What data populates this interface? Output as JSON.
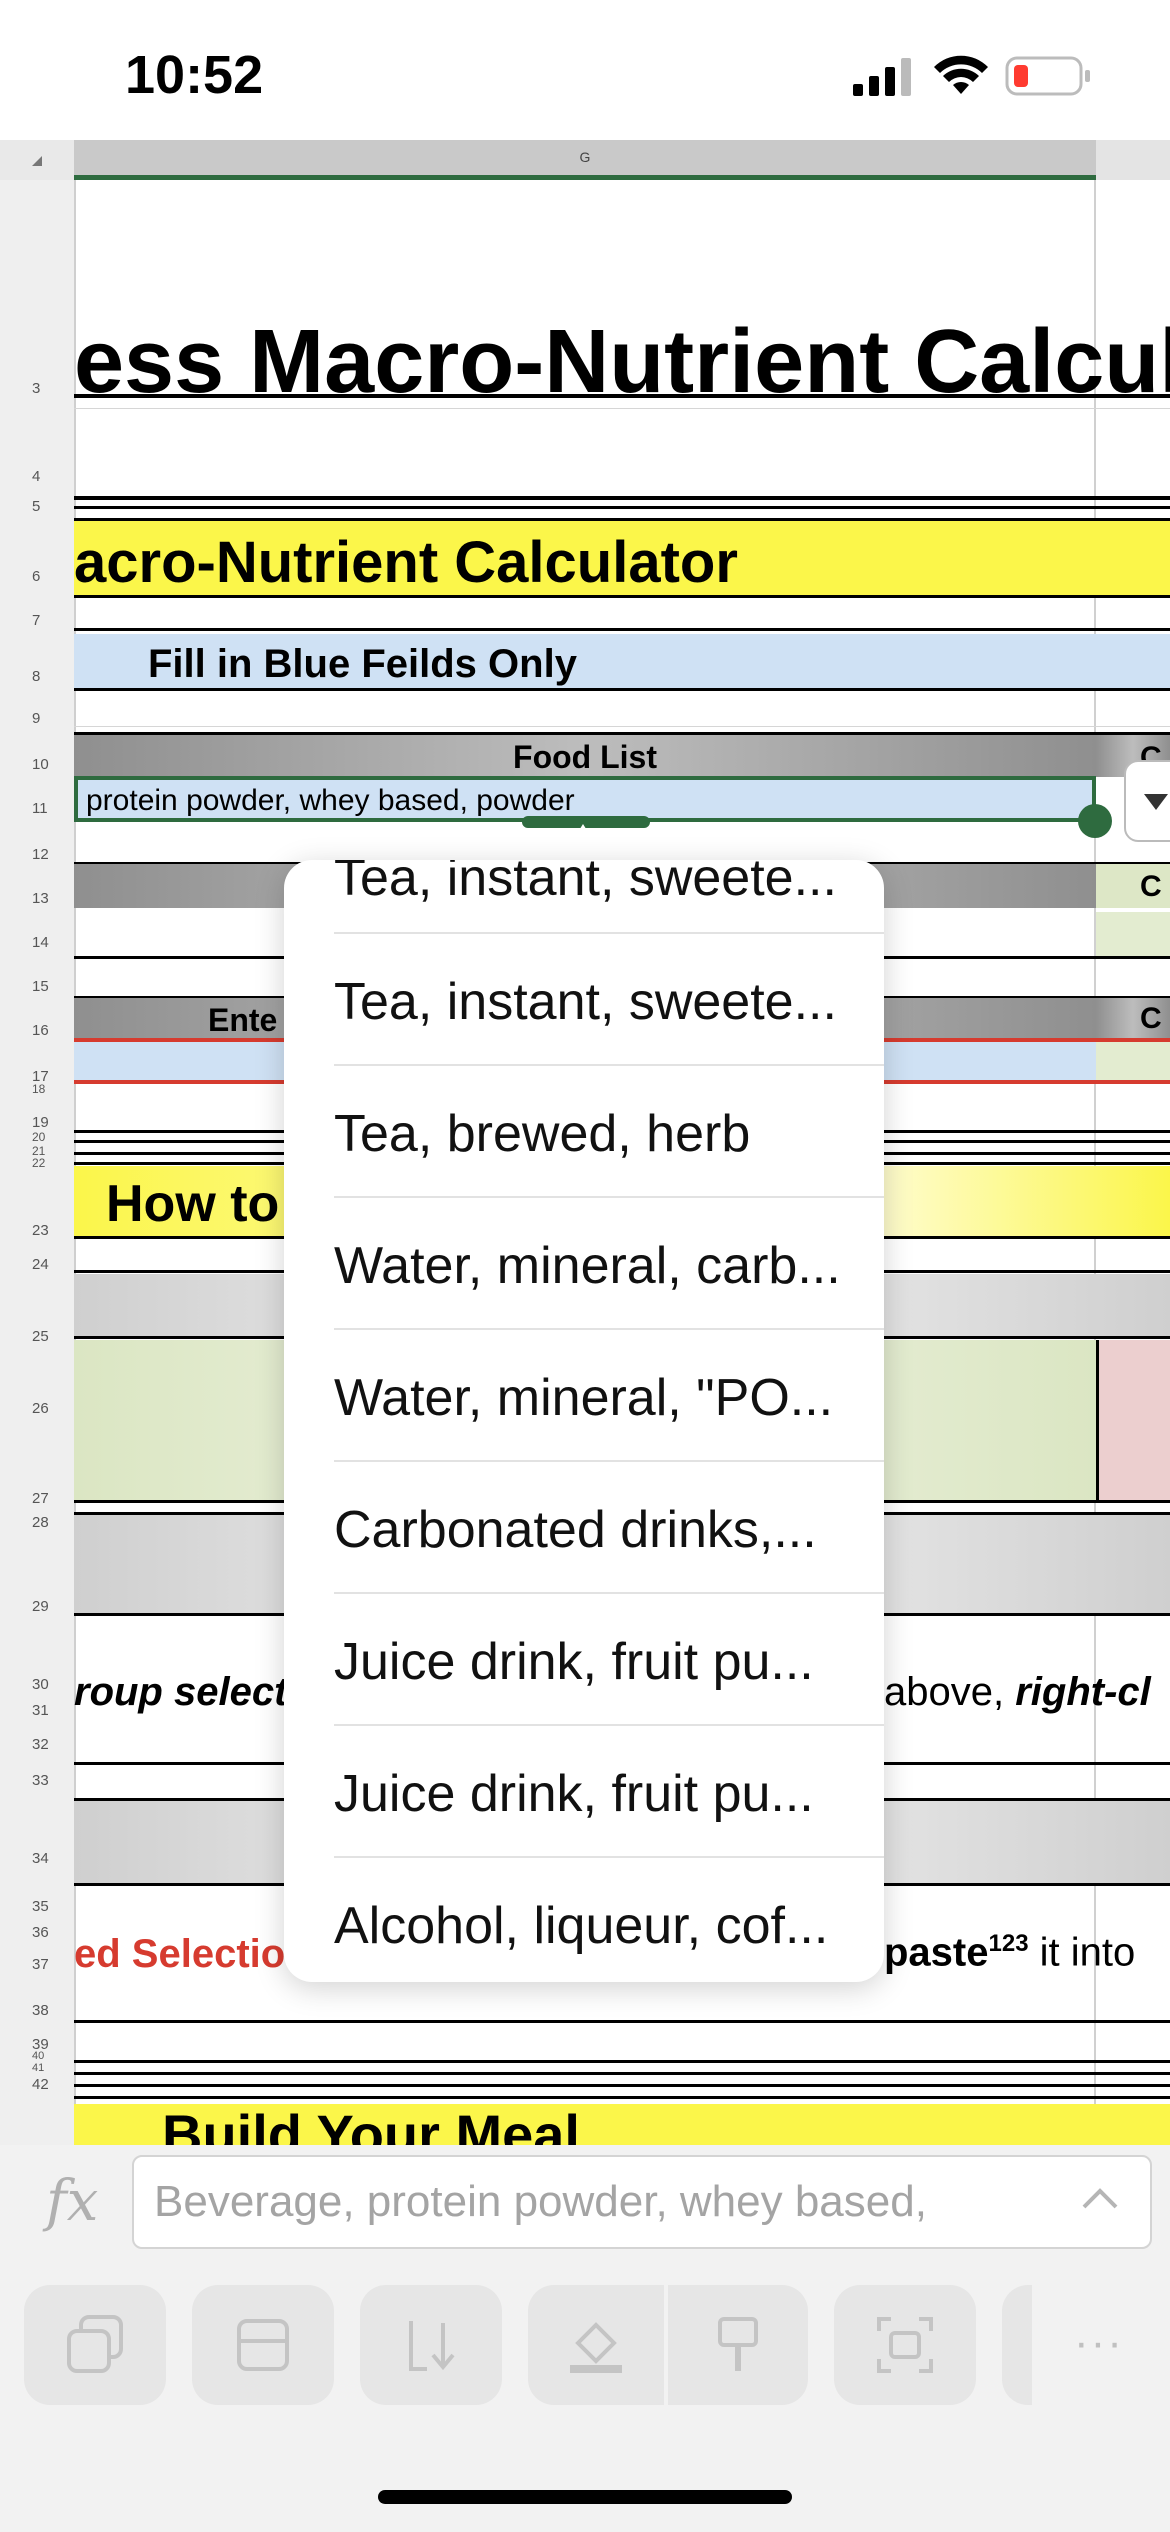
{
  "status_bar": {
    "time": "10:52"
  },
  "sheet": {
    "column_header": "G",
    "row_numbers": [
      "3",
      "4",
      "5",
      "6",
      "7",
      "8",
      "9",
      "10",
      "11",
      "12",
      "13",
      "14",
      "15",
      "16",
      "17",
      "18",
      "19",
      "20",
      "21",
      "22",
      "23",
      "24",
      "25",
      "26",
      "27",
      "28",
      "29",
      "30",
      "31",
      "32",
      "33",
      "34",
      "35",
      "36",
      "37",
      "38",
      "39",
      "40",
      "41",
      "42"
    ],
    "title": "ess Macro-Nutrient Calcula",
    "subtitle": "acro-Nutrient Calculator",
    "instruction": "Fill in Blue Feilds Only",
    "food_list_header": "Food List",
    "selected_cell": "protein powder, whey based, powder",
    "enter_label": "Ente",
    "how_to_label": "How to",
    "group_select_text": "roup select",
    "above_text": "above, ",
    "right_click_text": "right-cl",
    "selection_text": "ed Selectio",
    "paste_text": "paste",
    "paste_sup": "123",
    "into_text": " it into",
    "build_meal": "Build Your Meal",
    "right_col_partial": [
      "C",
      "C",
      "C"
    ]
  },
  "dropdown": {
    "items": [
      "Tea, instant, sweete...",
      "Tea, instant, sweete...",
      "Tea, brewed, herb",
      "Water, mineral, carb...",
      "Water, mineral, \"PO...",
      "Carbonated drinks,...",
      "Juice drink, fruit pu...",
      "Juice drink, fruit pu...",
      "Alcohol, liqueur, cof..."
    ]
  },
  "formula_bar": {
    "fx_label": "fx",
    "value": "Beverage, protein powder, whey based,"
  },
  "toolbar": {
    "buttons": [
      "copy-icon",
      "row-insert-icon",
      "fill-down-icon",
      "fill-color-icon",
      "format-painter-icon",
      "screenshot-icon"
    ],
    "more": "···"
  },
  "colors": {
    "yellow": "#fbf64a",
    "blue": "#cfe1f4",
    "green_cell": "#e3ecd0",
    "red_cell": "#eccfcf",
    "accent_green": "#2e6b3f"
  }
}
